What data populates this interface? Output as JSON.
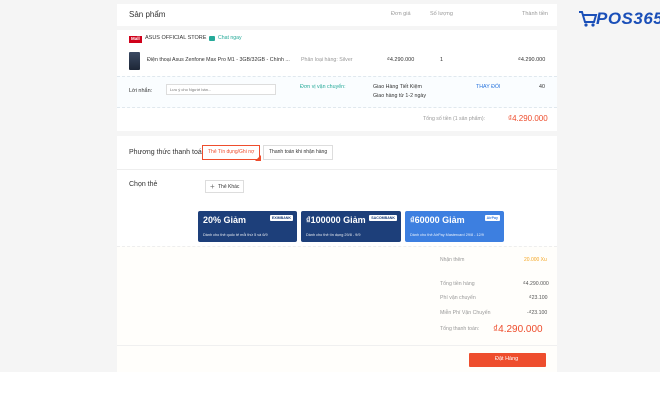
{
  "logo": {
    "text": "POS365",
    "icon": "shopping-cart-icon"
  },
  "products_header": {
    "title": "Sản phẩm",
    "col_price": "Đơn giá",
    "col_qty": "Số lượng",
    "col_total": "Thành tiền"
  },
  "shop": {
    "mall_badge": "Mall",
    "name": "ASUS OFFICIAL STORE",
    "chat_label": "Chat ngay"
  },
  "item": {
    "name": "Điện thoại Asus Zenfone Max Pro M1 - 3GB/32GB - Chính ...",
    "variant": "Phân loại hàng: Silver",
    "price": "₫4.290.000",
    "qty": "1",
    "subtotal": "₫4.290.000"
  },
  "note": {
    "label": "Lời nhắn:",
    "placeholder": "Lưu ý cho Người bán..."
  },
  "shipping": {
    "label": "Đơn vị vận chuyển:",
    "method": "Giao Hàng Tiết Kiệm",
    "eta": "Giao hàng từ 1-2 ngày",
    "change_label": "THAY ĐỔI",
    "fee": "40"
  },
  "order_total": {
    "label": "Tổng số tiền (1 sản phẩm):",
    "value": "₫4.290.000"
  },
  "payment": {
    "label": "Phương thức thanh toán",
    "options": [
      "Thẻ Tín dụng/Ghi nợ",
      "Thanh toán khi nhận hàng"
    ]
  },
  "card_select": {
    "label": "Chọn thẻ",
    "add_label": "Thẻ Khác"
  },
  "vouchers": [
    {
      "title": "20% Giảm",
      "desc": "Dành cho thẻ quốc tế mỗi thứ 5 và 6/9",
      "bank": "EXIMBANK",
      "color": "#1d3f7a"
    },
    {
      "title": "₫100000 Giảm",
      "desc": "Dành cho thẻ tín dụng 29/8 - 9/9",
      "bank": "SACOMBANK",
      "color": "#1d3f7a"
    },
    {
      "title": "₫60000 Giảm",
      "desc": "Dành cho thẻ AirPay Mastercard 29/8 - 12/9",
      "bank": "AirPay",
      "color": "#3d7fe0"
    }
  ],
  "summary": {
    "coins_label": "Nhận thêm",
    "coins_value": "20.000 Xu",
    "rows": [
      {
        "label": "Tổng tiền hàng",
        "value": "₫4.290.000"
      },
      {
        "label": "Phí vận chuyển",
        "value": "₫23.100"
      },
      {
        "label": "Miễn Phí Vận Chuyển",
        "value": "-₫23.100"
      }
    ],
    "grand_label": "Tổng thanh toán:",
    "grand_value": "₫4.290.000",
    "order_button": "Đặt Hàng"
  }
}
